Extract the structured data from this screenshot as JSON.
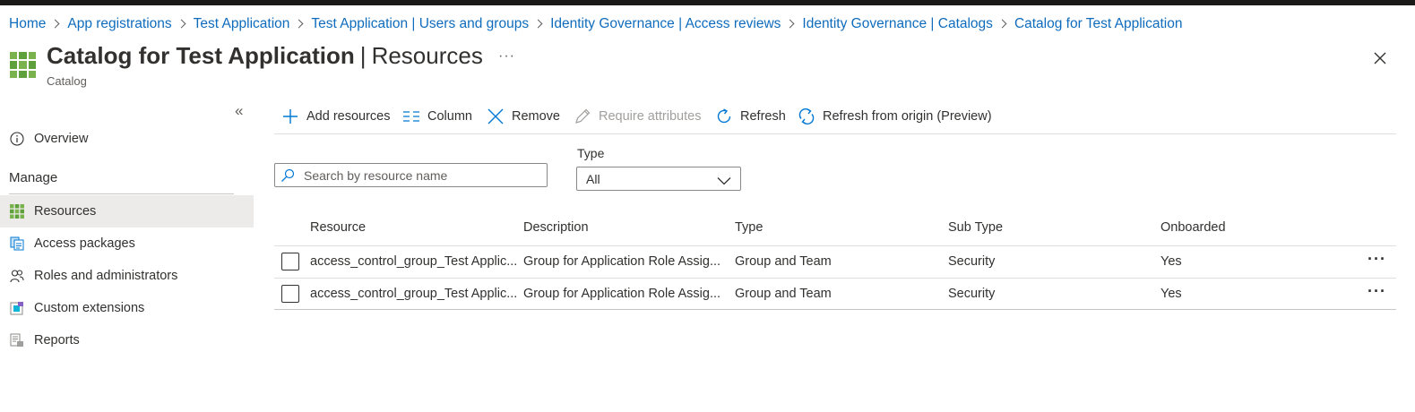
{
  "breadcrumb": [
    "Home",
    "App registrations",
    "Test Application",
    "Test Application | Users and groups",
    "Identity Governance | Access reviews",
    "Identity Governance | Catalogs",
    "Catalog for Test Application"
  ],
  "header": {
    "title": "Catalog for Test Application",
    "separator": "|",
    "section": "Resources",
    "more": "···",
    "subtitle": "Catalog"
  },
  "sidebar": {
    "collapse": "«",
    "overview": "Overview",
    "section": "Manage",
    "items": [
      {
        "label": "Resources",
        "icon": "resources-grid-icon",
        "active": true
      },
      {
        "label": "Access packages",
        "icon": "access-package-icon",
        "active": false
      },
      {
        "label": "Roles and administrators",
        "icon": "people-icon",
        "active": false
      },
      {
        "label": "Custom extensions",
        "icon": "custom-extension-icon",
        "active": false
      },
      {
        "label": "Reports",
        "icon": "reports-icon",
        "active": false
      }
    ]
  },
  "toolbar": {
    "add": "Add resources",
    "column": "Column",
    "remove": "Remove",
    "require": "Require attributes",
    "refresh": "Refresh",
    "refresh_origin": "Refresh from origin (Preview)"
  },
  "search": {
    "placeholder": "Search by resource name",
    "value": ""
  },
  "filter": {
    "type_label": "Type",
    "type_value": "All"
  },
  "table": {
    "columns": [
      "Resource",
      "Description",
      "Type",
      "Sub Type",
      "Onboarded"
    ],
    "rows": [
      [
        "access_control_group_Test Applic...",
        "Group for Application Role Assig...",
        "Group and Team",
        "Security",
        "Yes"
      ],
      [
        "access_control_group_Test Applic...",
        "Group for Application Role Assig...",
        "Group and Team",
        "Security",
        "Yes"
      ]
    ],
    "row_more": "···"
  },
  "colors": {
    "link": "#0f6cbd",
    "accent": "#0078d4",
    "grid_icon": "#5ea03b",
    "active_nav": "#edebe9"
  }
}
